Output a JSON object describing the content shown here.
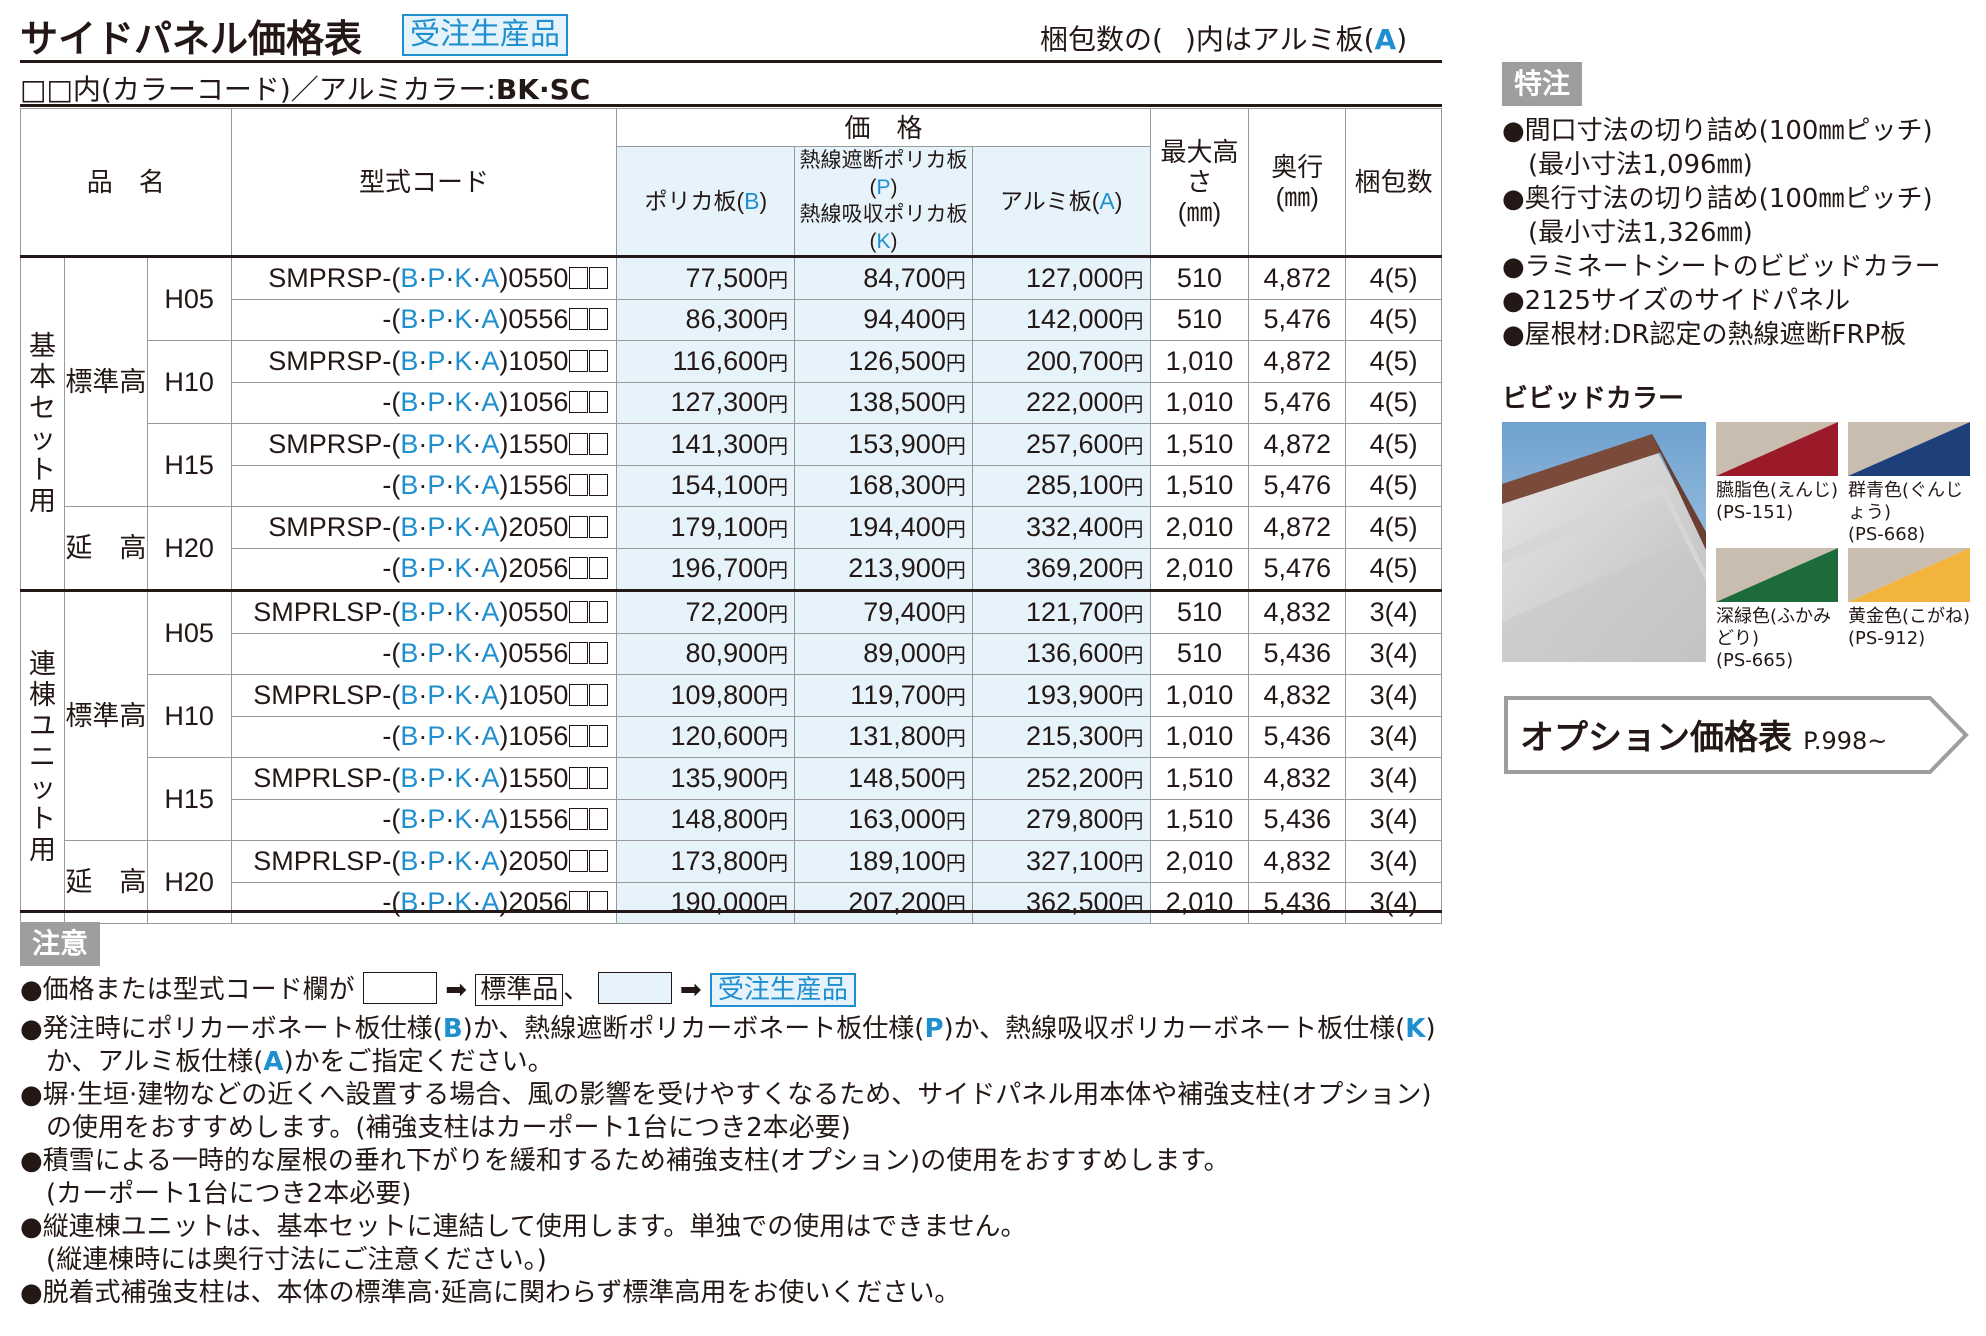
{
  "title": "サイドパネル価格表",
  "badge": "受注生産品",
  "pack_note_pre": "梱包数の(",
  "pack_note_mid": ")内はアルミ板(",
  "pack_note_a": "A",
  "pack_note_post": ")",
  "color_code_note": "□□内(カラーコード)／アルミカラー:",
  "color_code_value": "BK·SC",
  "headers": {
    "name": "品　名",
    "code": "型式コード",
    "price": "価　格",
    "polyB": "ポリカ板(",
    "polyB_letter": "B",
    "polyB_end": ")",
    "heatP1": "熱線遮断ポリカ板(",
    "heatP_letter": "P",
    "heatP_end": ")",
    "heatK1": "熱線吸収ポリカ板(",
    "heatK_letter": "K",
    "heatK_end": ")",
    "aluA": "アルミ板(",
    "aluA_letter": "A",
    "aluA_end": ")",
    "maxh": "最大高さ",
    "maxh_unit": "(㎜)",
    "depth": "奥行",
    "depth_unit": "(㎜)",
    "pack": "梱包数"
  },
  "yen": "円",
  "groups": [
    {
      "name": "基本セット用",
      "rows": [
        {
          "sub": "標準高",
          "size": "H05",
          "code": "SMPRSP-",
          "letters": "(B·P·K·A)",
          "suffix": "0550",
          "b": "77,500",
          "p": "84,700",
          "a": "127,000",
          "h": "510",
          "d": "4,872",
          "pk": "4(5)"
        },
        {
          "sub": "",
          "size": "",
          "code": "-",
          "letters": "(B·P·K·A)",
          "suffix": "0556",
          "b": "86,300",
          "p": "94,400",
          "a": "142,000",
          "h": "510",
          "d": "5,476",
          "pk": "4(5)"
        },
        {
          "sub": "",
          "size": "H10",
          "code": "SMPRSP-",
          "letters": "(B·P·K·A)",
          "suffix": "1050",
          "b": "116,600",
          "p": "126,500",
          "a": "200,700",
          "h": "1,010",
          "d": "4,872",
          "pk": "4(5)"
        },
        {
          "sub": "",
          "size": "",
          "code": "-",
          "letters": "(B·P·K·A)",
          "suffix": "1056",
          "b": "127,300",
          "p": "138,500",
          "a": "222,000",
          "h": "1,010",
          "d": "5,476",
          "pk": "4(5)"
        },
        {
          "sub": "",
          "size": "H15",
          "code": "SMPRSP-",
          "letters": "(B·P·K·A)",
          "suffix": "1550",
          "b": "141,300",
          "p": "153,900",
          "a": "257,600",
          "h": "1,510",
          "d": "4,872",
          "pk": "4(5)"
        },
        {
          "sub": "",
          "size": "",
          "code": "-",
          "letters": "(B·P·K·A)",
          "suffix": "1556",
          "b": "154,100",
          "p": "168,300",
          "a": "285,100",
          "h": "1,510",
          "d": "5,476",
          "pk": "4(5)"
        },
        {
          "sub": "延　高",
          "size": "H20",
          "code": "SMPRSP-",
          "letters": "(B·P·K·A)",
          "suffix": "2050",
          "b": "179,100",
          "p": "194,400",
          "a": "332,400",
          "h": "2,010",
          "d": "4,872",
          "pk": "4(5)"
        },
        {
          "sub": "",
          "size": "",
          "code": "-",
          "letters": "(B·P·K·A)",
          "suffix": "2056",
          "b": "196,700",
          "p": "213,900",
          "a": "369,200",
          "h": "2,010",
          "d": "5,476",
          "pk": "4(5)"
        }
      ]
    },
    {
      "name": "連棟ユニット用",
      "rows": [
        {
          "sub": "標準高",
          "size": "H05",
          "code": "SMPRLSP-",
          "letters": "(B·P·K·A)",
          "suffix": "0550",
          "b": "72,200",
          "p": "79,400",
          "a": "121,700",
          "h": "510",
          "d": "4,832",
          "pk": "3(4)"
        },
        {
          "sub": "",
          "size": "",
          "code": "-",
          "letters": "(B·P·K·A)",
          "suffix": "0556",
          "b": "80,900",
          "p": "89,000",
          "a": "136,600",
          "h": "510",
          "d": "5,436",
          "pk": "3(4)"
        },
        {
          "sub": "",
          "size": "H10",
          "code": "SMPRLSP-",
          "letters": "(B·P·K·A)",
          "suffix": "1050",
          "b": "109,800",
          "p": "119,700",
          "a": "193,900",
          "h": "1,010",
          "d": "4,832",
          "pk": "3(4)"
        },
        {
          "sub": "",
          "size": "",
          "code": "-",
          "letters": "(B·P·K·A)",
          "suffix": "1056",
          "b": "120,600",
          "p": "131,800",
          "a": "215,300",
          "h": "1,010",
          "d": "5,436",
          "pk": "3(4)"
        },
        {
          "sub": "",
          "size": "H15",
          "code": "SMPRLSP-",
          "letters": "(B·P·K·A)",
          "suffix": "1550",
          "b": "135,900",
          "p": "148,500",
          "a": "252,200",
          "h": "1,510",
          "d": "4,832",
          "pk": "3(4)"
        },
        {
          "sub": "",
          "size": "",
          "code": "-",
          "letters": "(B·P·K·A)",
          "suffix": "1556",
          "b": "148,800",
          "p": "163,000",
          "a": "279,800",
          "h": "1,510",
          "d": "5,436",
          "pk": "3(4)"
        },
        {
          "sub": "延　高",
          "size": "H20",
          "code": "SMPRLSP-",
          "letters": "(B·P·K·A)",
          "suffix": "2050",
          "b": "173,800",
          "p": "189,100",
          "a": "327,100",
          "h": "2,010",
          "d": "4,832",
          "pk": "3(4)"
        },
        {
          "sub": "",
          "size": "",
          "code": "-",
          "letters": "(B·P·K·A)",
          "suffix": "2056",
          "b": "190,000",
          "p": "207,200",
          "a": "362,500",
          "h": "2,010",
          "d": "5,436",
          "pk": "3(4)"
        }
      ]
    }
  ],
  "special": {
    "label": "特注",
    "items": [
      "●間口寸法の切り詰め(100㎜ピッチ)",
      "(最小寸法1,096㎜)",
      "●奥行寸法の切り詰め(100㎜ピッチ)",
      "(最小寸法1,326㎜)",
      "●ラミネートシートのビビッドカラー",
      "●2125サイズのサイドパネル",
      "●屋根材:DR認定の熱線遮断FRP板"
    ]
  },
  "vivid": {
    "label": "ビビッドカラー",
    "swatches": [
      {
        "name": "臙脂色(えんじ)",
        "code": "(PS-151)",
        "color": "#9a1a2a"
      },
      {
        "name": "群青色(ぐんじょう)",
        "code": "(PS-668)",
        "color": "#1d3f7a"
      },
      {
        "name": "深緑色(ふかみどり)",
        "code": "(PS-665)",
        "color": "#1d6a3a"
      },
      {
        "name": "黄金色(こがね)",
        "code": "(PS-912)",
        "color": "#f2b43c"
      }
    ]
  },
  "option": {
    "label": "オプション価格表",
    "page": "P.998~"
  },
  "notes": {
    "label": "注意",
    "n1_pre": "●価格または型式コード欄が",
    "n1_std": "標準品",
    "n1_mid": "、",
    "n1_order": "受注生産品",
    "n2a": "●発注時にポリカーボネート板仕様(",
    "B": "B",
    "n2b": ")か、熱線遮断ポリカーボネート板仕様(",
    "P": "P",
    "n2c": ")か、熱線吸収ポリカーボネート板仕様(",
    "K": "K",
    "n2d": ")",
    "n2e": "か、アルミ板仕様(",
    "A": "A",
    "n2f": ")かをご指定ください。",
    "n3a": "●塀·生垣·建物などの近くへ設置する場合、風の影響を受けやすくなるため、サイドパネル用本体や補強支柱(オプション)",
    "n3b": "の使用をおすすめします。(補強支柱はカーポート1台につき2本必要)",
    "n4a": "●積雪による一時的な屋根の垂れ下がりを緩和するため補強支柱(オプション)の使用をおすすめします。",
    "n4b": "(カーポート1台につき2本必要)",
    "n5a": "●縦連棟ユニットは、基本セットに連結して使用します。単独での使用はできません。",
    "n5b": "(縦連棟時には奥行寸法にご注意ください。)",
    "n6": "●脱着式補強支柱は、本体の標準高·延高に関わらず標準高用をお使いください。"
  }
}
